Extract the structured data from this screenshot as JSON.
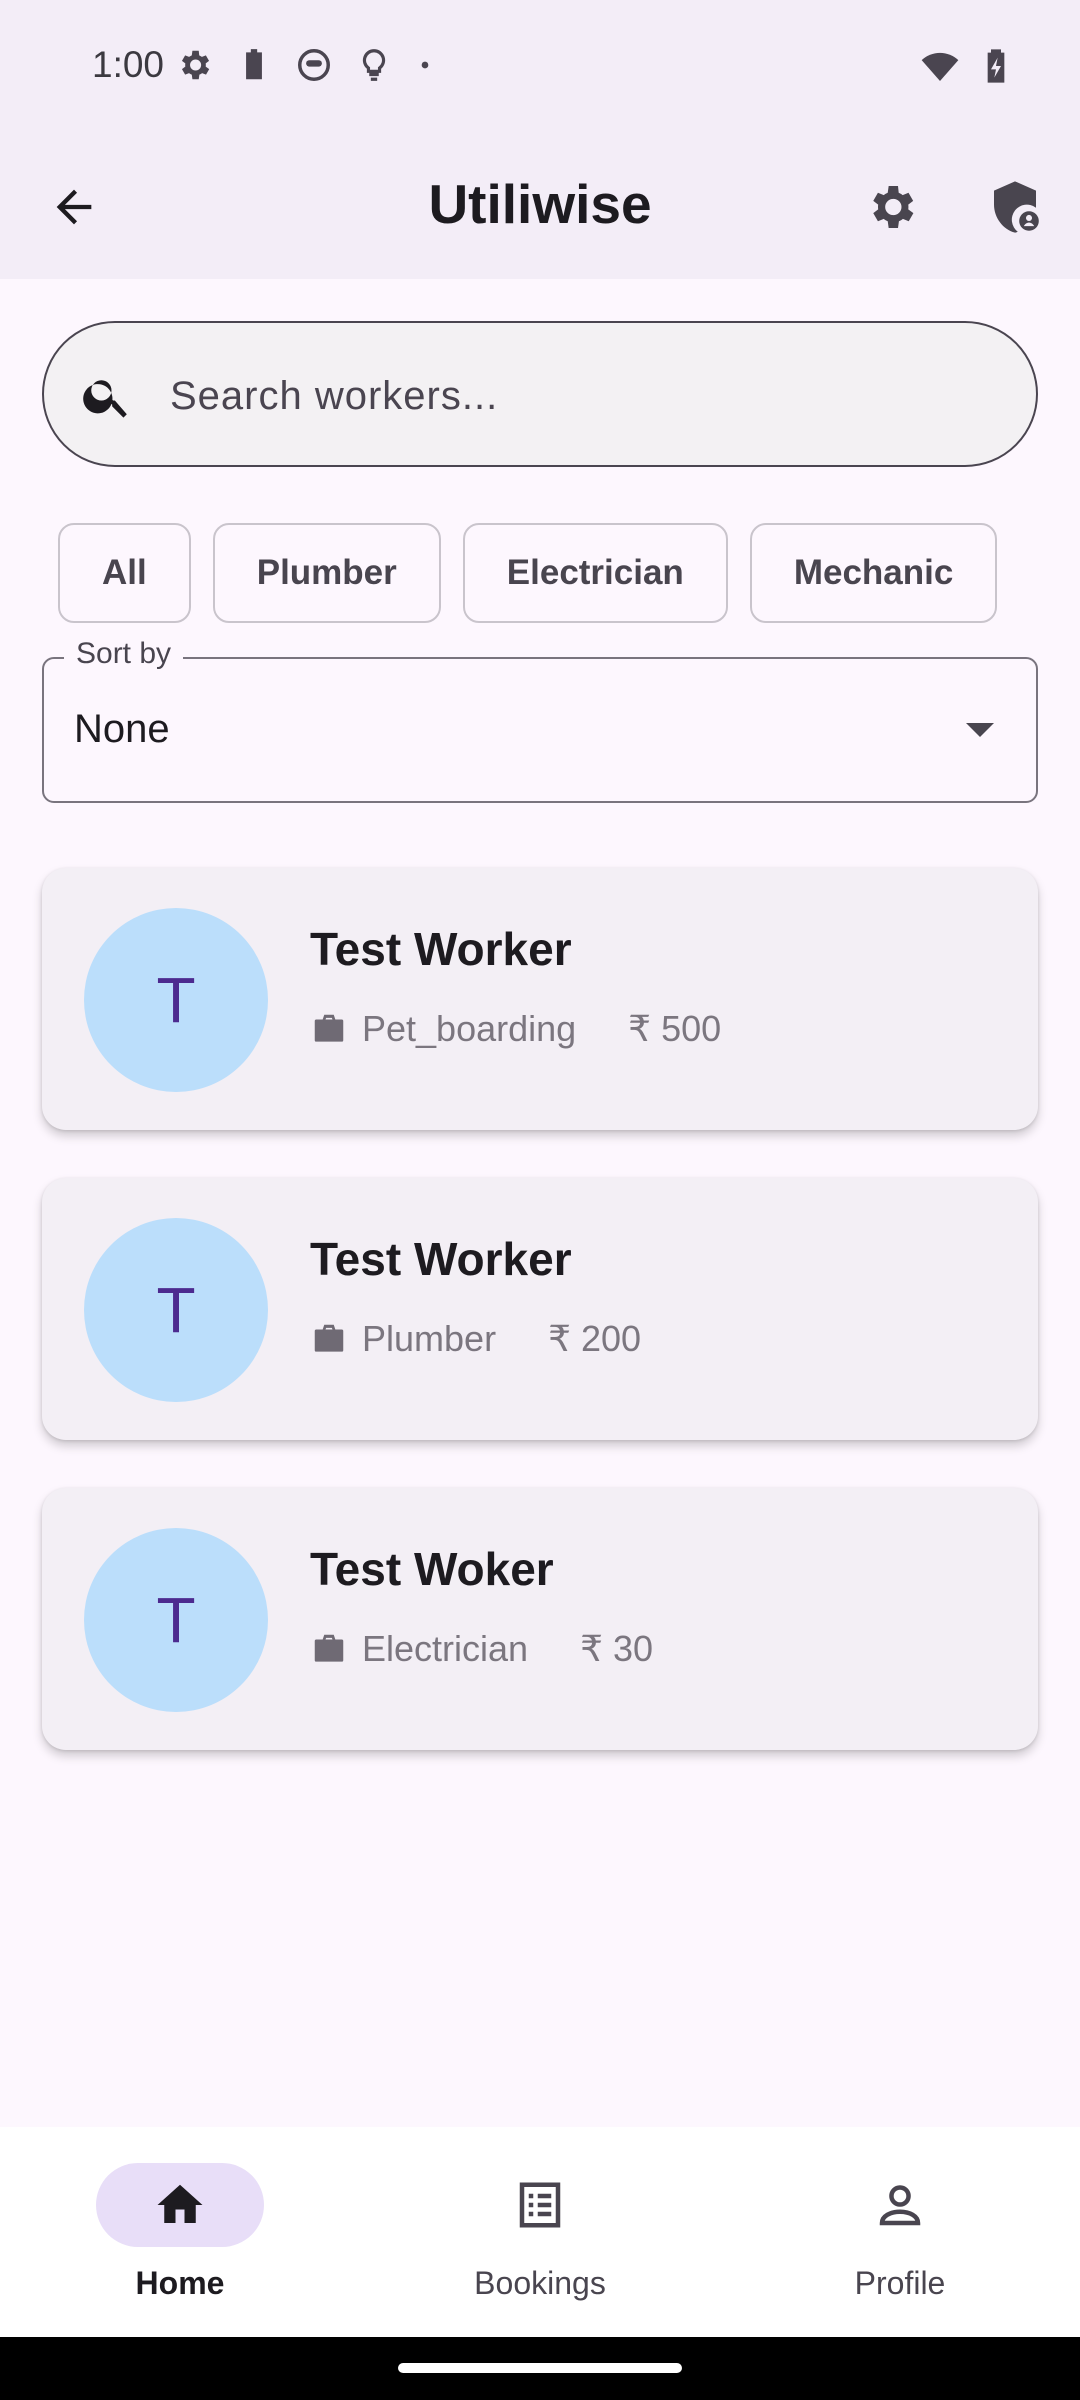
{
  "status_bar": {
    "time": "1:00"
  },
  "app_bar": {
    "title": "Utiliwise"
  },
  "search": {
    "placeholder": "Search workers..."
  },
  "filters": [
    "All",
    "Plumber",
    "Electrician",
    "Mechanic"
  ],
  "sort": {
    "label": "Sort by",
    "value": "None"
  },
  "workers": [
    {
      "initial": "T",
      "name": "Test Worker",
      "category": "Pet_boarding",
      "currency": "₹",
      "price": "500"
    },
    {
      "initial": "T",
      "name": "Test Worker",
      "category": "Plumber",
      "currency": "₹",
      "price": "200"
    },
    {
      "initial": "T",
      "name": "Test Woker",
      "category": "Electrician",
      "currency": "₹",
      "price": "30"
    }
  ],
  "bottom_nav": [
    {
      "label": "Home",
      "active": true
    },
    {
      "label": "Bookings",
      "active": false
    },
    {
      "label": "Profile",
      "active": false
    }
  ],
  "colors": {
    "background": "#fdf7fe",
    "app_bar": "#f3edf7",
    "card": "#f3eff5",
    "avatar": "#bbdefb",
    "avatar_text": "#4c2a8f",
    "nav_active_pill": "#e8def8"
  }
}
